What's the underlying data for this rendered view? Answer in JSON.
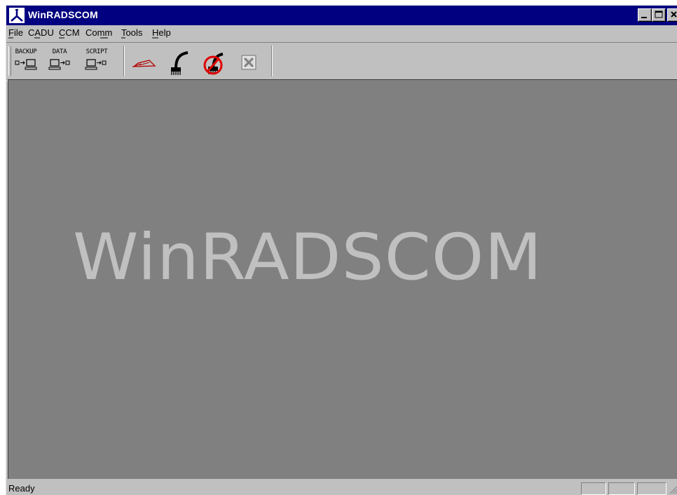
{
  "window": {
    "title": "WinRADSCOM"
  },
  "menu": [
    "File",
    "CADU",
    "CCM",
    "Comm",
    "Tools",
    "Help"
  ],
  "toolbar": {
    "backup_label": "BACKUP",
    "data_label": "DATA",
    "script_label": "SCRIPT"
  },
  "main": {
    "logo_text": "WinRADSCOM"
  },
  "status": {
    "text": "Ready"
  },
  "colors": {
    "titlebar": "#000080",
    "client": "#808080",
    "logo": "#c0c0c0",
    "chrome": "#c0c0c0",
    "accent_red": "#cc0000"
  }
}
